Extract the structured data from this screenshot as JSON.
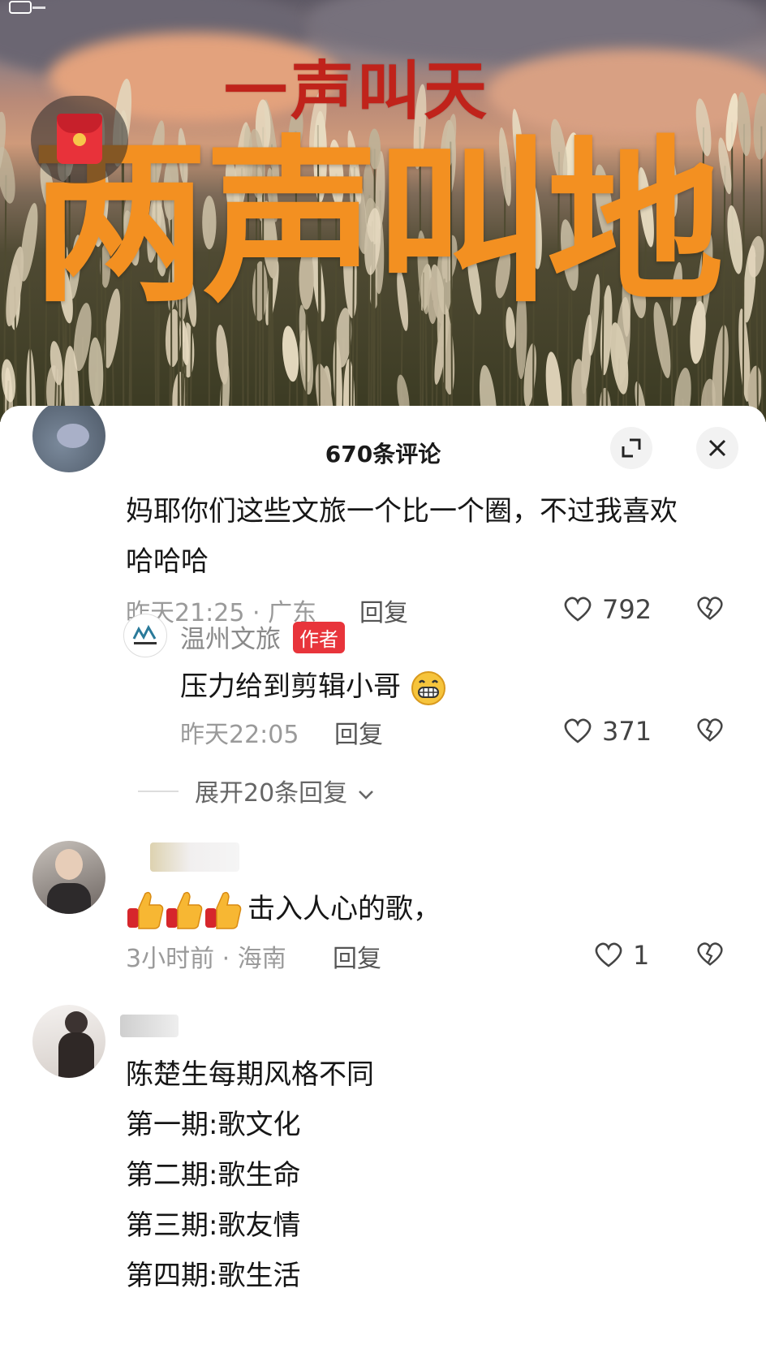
{
  "video": {
    "title_line1": "一声叫天",
    "title_line2": "两声叫地",
    "brand_mark": "温州文旅"
  },
  "sheet": {
    "title": "670条评论"
  },
  "comments": [
    {
      "text": "妈耶你们这些文旅一个比一个圈，不过我喜欢",
      "text2": "哈哈哈",
      "time": "昨天21:25 · 广东",
      "reply": "回复",
      "likes": "792"
    },
    {
      "author": "温州文旅",
      "badge": "作者",
      "text": "压力给到剪辑小哥",
      "time": "昨天22:05",
      "reply": "回复",
      "likes": "371"
    },
    {
      "expand": "展开20条回复"
    },
    {
      "text": "击入人心的歌，",
      "time": "3小时前 · 海南",
      "reply": "回复",
      "likes": "1"
    },
    {
      "lines": [
        "陈楚生每期风格不同",
        "第一期:歌文化",
        "第二期:歌生命",
        "第三期:歌友情",
        "第四期:歌生活"
      ]
    }
  ],
  "colors": {
    "title_red": "#c0231b",
    "title_orange": "#f39021",
    "badge_red": "#e8343b"
  },
  "icons": [
    "expand-icon",
    "close-icon",
    "heart-icon",
    "broken-heart-icon",
    "chevron-down-icon",
    "red-packet-icon",
    "thumbs-up-icon",
    "grin-emoji-icon"
  ]
}
